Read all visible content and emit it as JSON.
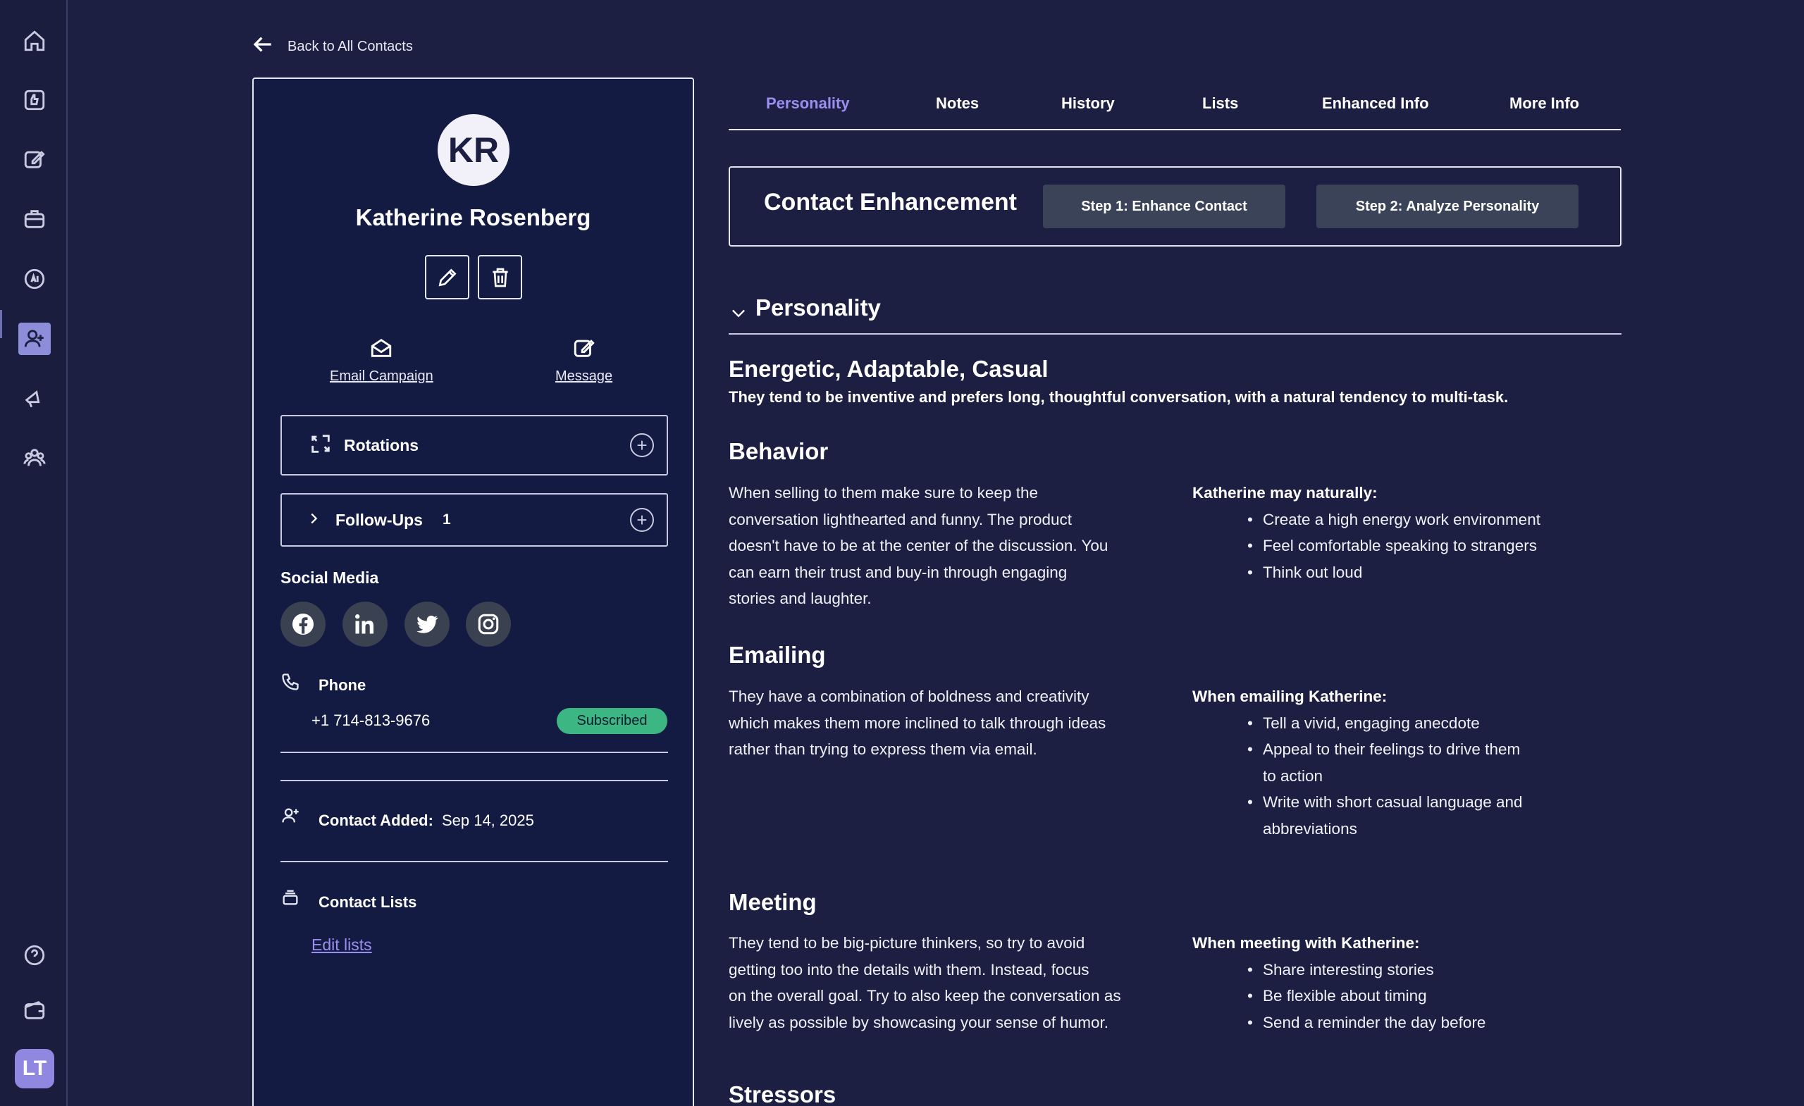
{
  "back_link": "Back to All Contacts",
  "contact": {
    "initials": "KR",
    "name": "Katherine Rosenberg",
    "actions": {
      "email_campaign": "Email Campaign",
      "message": "Message"
    },
    "rotations": "Rotations",
    "followups": {
      "label": "Follow-Ups",
      "count": "1"
    },
    "social_title": "Social Media",
    "phone": {
      "label": "Phone",
      "number": "+1 714-813-9676",
      "status": "Subscribed"
    },
    "added": {
      "label": "Contact Added:",
      "date": "Sep 14, 2025"
    },
    "lists": {
      "label": "Contact Lists",
      "edit": "Edit lists"
    }
  },
  "user_initials": "LT",
  "tabs": [
    "Personality",
    "Notes",
    "History",
    "Lists",
    "Enhanced Info",
    "More Info"
  ],
  "enhancement": {
    "title": "Contact Enhancement",
    "step1": "Step 1: Enhance Contact",
    "step2": "Step 2: Analyze Personality"
  },
  "personality": {
    "section": "Personality",
    "traits": "Energetic, Adaptable, Casual",
    "summary": "They tend to be inventive and prefers long, thoughtful conversation, with a natural tendency to multi-task.",
    "behavior": {
      "title": "Behavior",
      "lines": [
        "When selling to them make sure to keep the",
        "conversation lighthearted and funny. The product",
        "doesn't have to be at the center of the discussion. You",
        "can earn their trust and buy-in through engaging",
        "stories and laughter."
      ],
      "side_title": "Katherine may naturally:",
      "bullets": [
        "Create a high energy work environment",
        "Feel comfortable speaking to strangers",
        "Think out loud"
      ]
    },
    "emailing": {
      "title": "Emailing",
      "lines": [
        "They have a combination of boldness and creativity",
        "which makes them more inclined to talk through ideas",
        "rather than trying to express them via email."
      ],
      "side_title": "When emailing Katherine:",
      "bullets": [
        "Tell a vivid, engaging anecdote",
        "Appeal to their feelings to drive them to action",
        "Write with short casual language and abbreviations"
      ]
    },
    "meeting": {
      "title": "Meeting",
      "lines": [
        "They tend to be big-picture thinkers, so try to avoid",
        "getting too into the details with them. Instead, focus",
        "on the overall goal. Try to also keep the conversation as",
        "lively as possible by showcasing your sense of humor."
      ],
      "side_title": "When meeting with Katherine:",
      "bullets": [
        "Share interesting stories",
        "Be flexible about timing",
        "Send a reminder the day before"
      ]
    },
    "stressors_title": "Stressors"
  },
  "colors": {
    "background": "#1c1f42",
    "card": "#141b43",
    "accent": "#9a8ff0",
    "subscribed": "#3cb783"
  }
}
